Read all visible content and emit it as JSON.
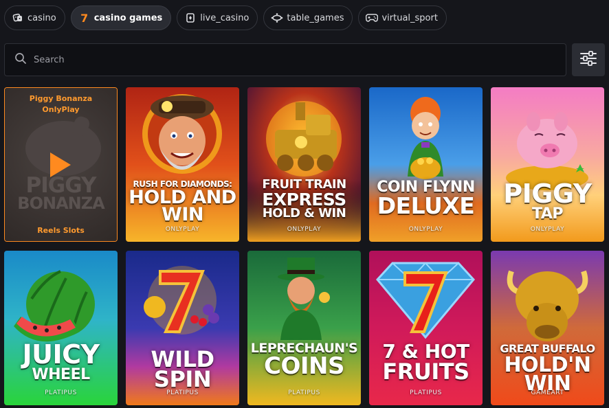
{
  "tabs": [
    {
      "label": "casino",
      "icon": "dice-icon",
      "active": false
    },
    {
      "label": "casino games",
      "icon": "seven-icon",
      "active": true
    },
    {
      "label": "live_casino",
      "icon": "playing-card-icon",
      "active": false
    },
    {
      "label": "table_games",
      "icon": "table-icon",
      "active": false
    },
    {
      "label": "virtual_sport",
      "icon": "gamepad-icon",
      "active": false
    }
  ],
  "tab_seven_glyph": "7",
  "search": {
    "placeholder": "Search",
    "value": ""
  },
  "filter_button": {
    "icon": "sliders-icon"
  },
  "featured": {
    "name": "Piggy Bonanza",
    "provider": "OnlyPlay",
    "category": "Reels Slots",
    "art_text_line1": "PIGGY",
    "art_text_line2": "BONANZA"
  },
  "games": [
    {
      "title_line1": "RUSH FOR DIAMONDS:",
      "title_line2": "HOLD AND WIN",
      "provider": "ONLYPLAY"
    },
    {
      "title_line1": "FRUIT TRAIN",
      "title_line2": "EXPRESS",
      "title_line3": "HOLD & WIN",
      "provider": "ONLYPLAY"
    },
    {
      "title_line1": "COIN FLYNN",
      "title_line2": "DELUXE",
      "provider": "ONLYPLAY"
    },
    {
      "title_line1": "PIGGY",
      "title_line2": "TAP",
      "provider": "ONLYPLAY"
    },
    {
      "title_line1": "JUICY",
      "title_line2": "WHEEL",
      "provider": "PLATIPUS"
    },
    {
      "title_line1": "WILD SPIN",
      "provider": "PLATIPUS"
    },
    {
      "title_line1": "LEPRECHAUN'S",
      "title_line2": "COINS",
      "provider": "PLATIPUS"
    },
    {
      "title_line1": "7 & HOT",
      "title_line2": "FRUITS",
      "provider": "PLATIPUS"
    },
    {
      "title_line1": "GREAT BUFFALO",
      "title_line2": "HOLD'N WIN",
      "provider": "GAMEART"
    }
  ],
  "colors": {
    "accent": "#ff8a1f",
    "background": "#15161b"
  }
}
